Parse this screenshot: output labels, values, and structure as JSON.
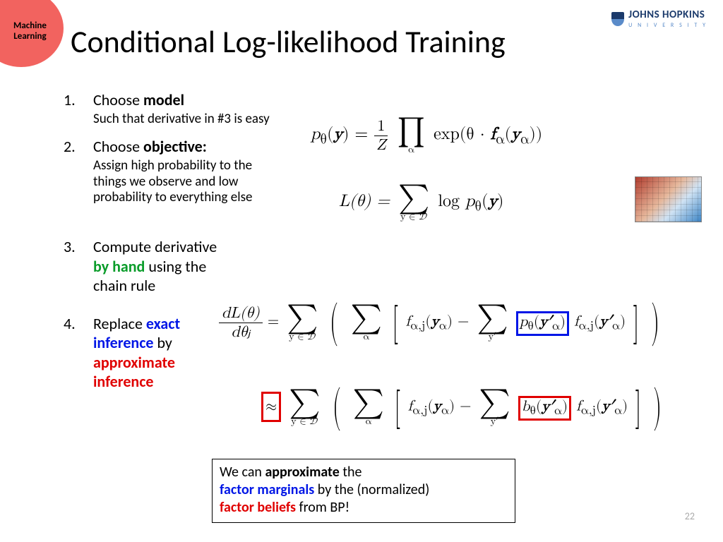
{
  "badge": "Machine\nLearning",
  "logo": {
    "main": "JOHNS HOPKINS",
    "sub": "U N I V E R S I T Y"
  },
  "title": "Conditional Log-likelihood Training",
  "items": [
    {
      "head_pre": "Choose ",
      "head_bold": "model",
      "sub": "Such that derivative in #3 is easy"
    },
    {
      "head_pre": "Choose ",
      "head_bold": "objective:",
      "sub": "Assign high probability to the things we observe and low probability to everything else"
    },
    {
      "line": "Compute derivative ",
      "emph": "by hand",
      "rest": " using the chain rule"
    },
    {
      "line": "Replace ",
      "emph1": "exact inference",
      "mid": " by ",
      "emph2": "approximate inference"
    }
  ],
  "eq1": {
    "lhs": "p",
    "sub_theta": "θ",
    "arg": "y",
    "eq": " = ",
    "frac_num": "1",
    "frac_den": "Z",
    "prod": "∏",
    "prod_sub": "α",
    "exp": "exp(θ · ",
    "f": "f",
    "f_sub": "α",
    "arg2": "y",
    "arg2_sub": "α",
    "close": "))"
  },
  "eq2": {
    "lhs": "L(θ) = ",
    "sum": "∑",
    "sum_sub": "y ∈ 𝒟",
    "log": "log ",
    "p": "p",
    "p_sub": "θ",
    "arg": "y",
    "close": ")"
  },
  "eq3": {
    "frac_num": "dL(θ)",
    "frac_den": "dθⱼ",
    "eq": " = ",
    "sum1": "∑",
    "sum1_sub": "y ∈ 𝒟",
    "sum2": "∑",
    "sum2_sub": "α",
    "f1": "f",
    "f1_sub": "α,j",
    "arg1": "y",
    "arg1_sub": "α",
    "minus": " − ",
    "sum3": "∑",
    "sum3_sub": "y′",
    "p": "p",
    "p_sub": "θ",
    "parg": "y′",
    "parg_sub": "α",
    "f2": "f",
    "f2_sub": "α,j",
    "arg2": "y′",
    "arg2_sub": "α"
  },
  "eq4": {
    "approx": "≈",
    "sum1": "∑",
    "sum1_sub": "y ∈ 𝒟",
    "sum2": "∑",
    "sum2_sub": "α",
    "f1": "f",
    "f1_sub": "α,j",
    "arg1": "y",
    "arg1_sub": "α",
    "minus": " − ",
    "sum3": "∑",
    "sum3_sub": "y′",
    "b": "b",
    "b_sub": "θ",
    "barg": "y′",
    "barg_sub": "α",
    "f2": "f",
    "f2_sub": "α,j",
    "arg2": "y′",
    "arg2_sub": "α"
  },
  "note": {
    "l1a": "We can ",
    "l1b": "approximate",
    "l1c": " the",
    "l2a": "factor marginals",
    "l2b": " by the (normalized)",
    "l3a": "factor beliefs",
    "l3b": " from BP!"
  },
  "pagenum": "22"
}
